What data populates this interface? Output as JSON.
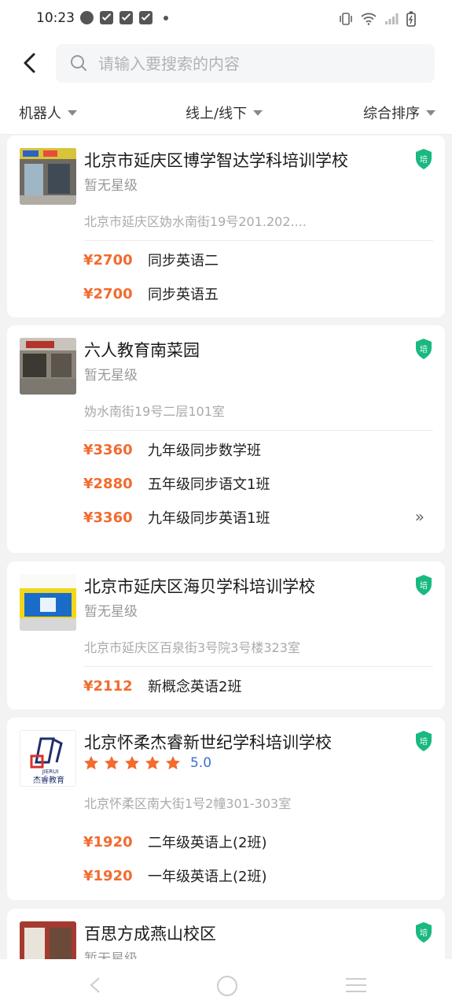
{
  "status_bar": {
    "time": "10:23"
  },
  "search": {
    "placeholder": "请输入要搜索的内容"
  },
  "filters": [
    {
      "label": "机器人"
    },
    {
      "label": "线上/线下"
    },
    {
      "label": "综合排序"
    }
  ],
  "colors": {
    "price": "#f26b2f",
    "shield": "#19b980",
    "star": "#f26b2f",
    "score": "#3a6fd6"
  },
  "schools": [
    {
      "name": "北京市延庆区博学智达学科培训学校",
      "rating": "暂无星级",
      "address": "北京市延庆区妫水南街19号201.202....",
      "courses": [
        {
          "price": "¥2700",
          "name": "同步英语二"
        },
        {
          "price": "¥2700",
          "name": "同步英语五"
        }
      ]
    },
    {
      "name": "六人教育南菜园",
      "rating": "暂无星级",
      "address": "妫水南街19号二层101室",
      "courses": [
        {
          "price": "¥3360",
          "name": "九年级同步数学班"
        },
        {
          "price": "¥2880",
          "name": "五年级同步语文1班"
        },
        {
          "price": "¥3360",
          "name": "九年级同步英语1班"
        }
      ],
      "more": "»"
    },
    {
      "name": "北京市延庆区海贝学科培训学校",
      "rating": "暂无星级",
      "address": "北京市延庆区百泉街3号院3号楼323室",
      "courses": [
        {
          "price": "¥2112",
          "name": "新概念英语2班"
        }
      ]
    },
    {
      "name": "北京怀柔杰睿新世纪学科培训学校",
      "stars": 5,
      "score": "5.0",
      "address": "北京怀柔区南大街1号2幢301-303室",
      "logo_text": "杰睿教育",
      "logo_sub": "JIERUI",
      "courses": [
        {
          "price": "¥1920",
          "name": "二年级英语上(2班)"
        },
        {
          "price": "¥1920",
          "name": "一年级英语上(2班)"
        }
      ]
    },
    {
      "name": "百思方成燕山校区",
      "rating": "暂无星级"
    }
  ],
  "shield_label": "培"
}
